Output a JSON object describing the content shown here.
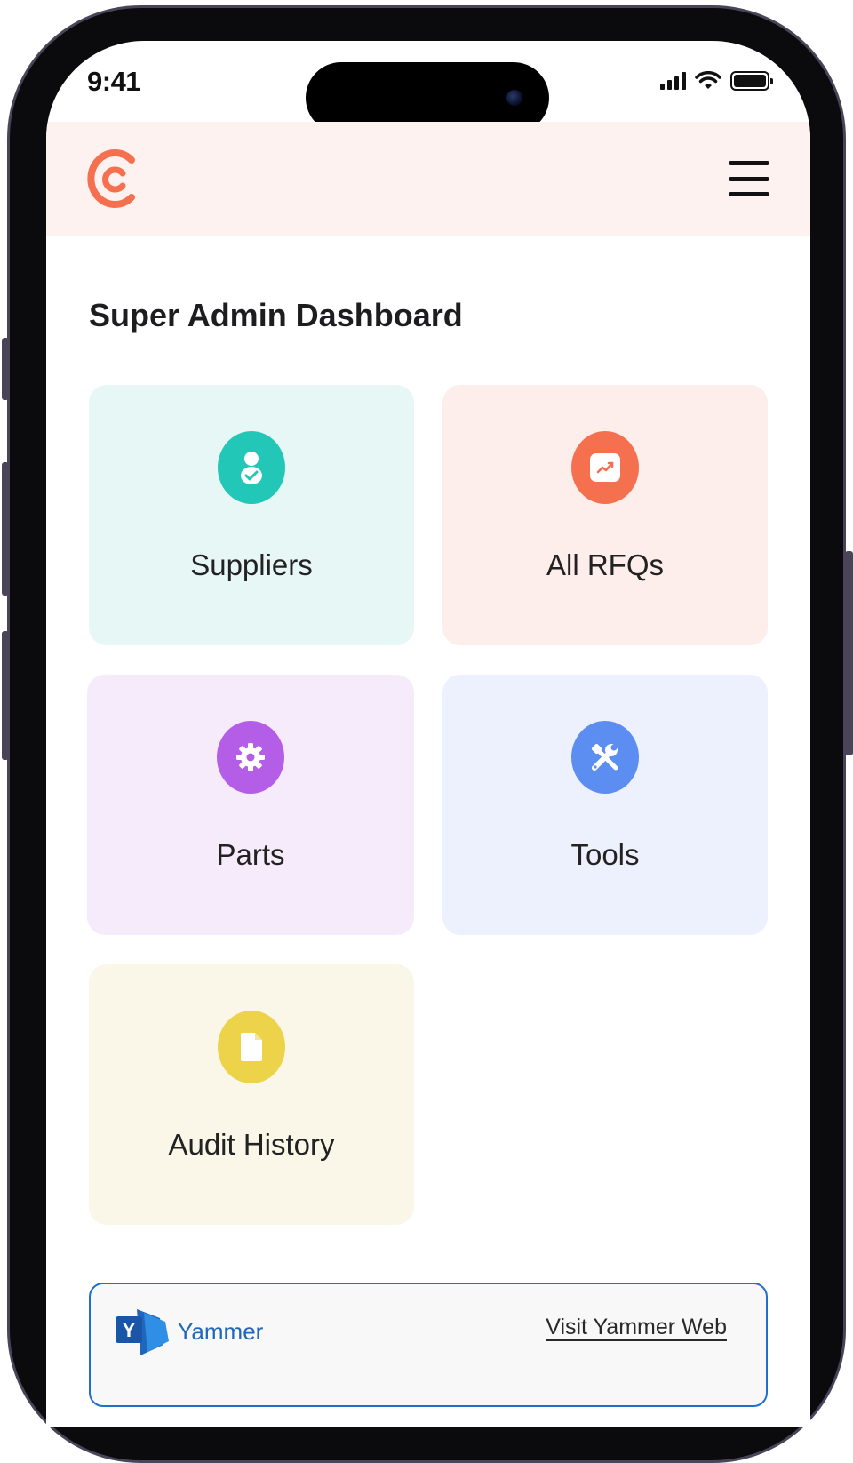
{
  "status_bar": {
    "time": "9:41"
  },
  "header": {
    "logo_icon": "brand-c-logo",
    "menu_icon": "hamburger-menu-icon"
  },
  "page": {
    "title": "Super Admin Dashboard"
  },
  "cards": [
    {
      "label": "Suppliers",
      "icon": "supplier-icon",
      "bg": "#e7f7f5",
      "icon_bg": "#22c7b8"
    },
    {
      "label": "All RFQs",
      "icon": "chart-trend-icon",
      "bg": "#fdeeeb",
      "icon_bg": "#f5704f"
    },
    {
      "label": "Parts",
      "icon": "gear-icon",
      "bg": "#f6ebfb",
      "icon_bg": "#b45ee8"
    },
    {
      "label": "Tools",
      "icon": "tools-icon",
      "bg": "#edf1fd",
      "icon_bg": "#5c8df0"
    },
    {
      "label": "Audit History",
      "icon": "document-icon",
      "bg": "#fbf7e8",
      "icon_bg": "#ecd34a"
    }
  ],
  "yammer": {
    "name": "Yammer",
    "logo_letter": "Y",
    "link_label": "Visit Yammer Web"
  },
  "colors": {
    "accent": "#f5704f",
    "header_bg": "#fdf2f0",
    "yammer_border": "#1e6fd0"
  }
}
